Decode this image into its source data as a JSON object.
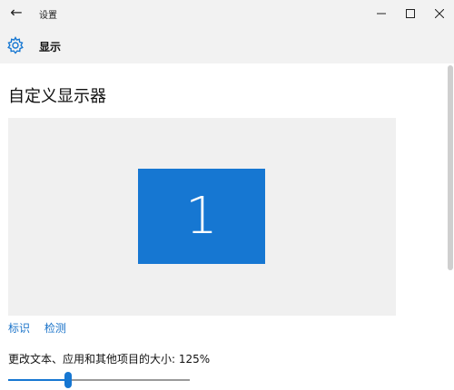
{
  "window": {
    "title": "设置",
    "controls": {
      "back": "back-arrow-icon",
      "minimize": "minimize-icon",
      "maximize": "maximize-icon",
      "close": "close-icon"
    }
  },
  "header": {
    "icon": "gear-icon",
    "title": "显示"
  },
  "main": {
    "page_title": "自定义显示器",
    "monitor": {
      "number": "1",
      "color": "#1677d2"
    },
    "links": {
      "identify": "标识",
      "detect": "检测"
    },
    "scale": {
      "label": "更改文本、应用和其他项目的大小: 125%",
      "position_fraction": 0.33
    }
  },
  "colors": {
    "accent": "#1677d2",
    "link": "#1a73c9",
    "chrome": "#f2f2f2",
    "preview_bg": "#f0f0f0"
  }
}
